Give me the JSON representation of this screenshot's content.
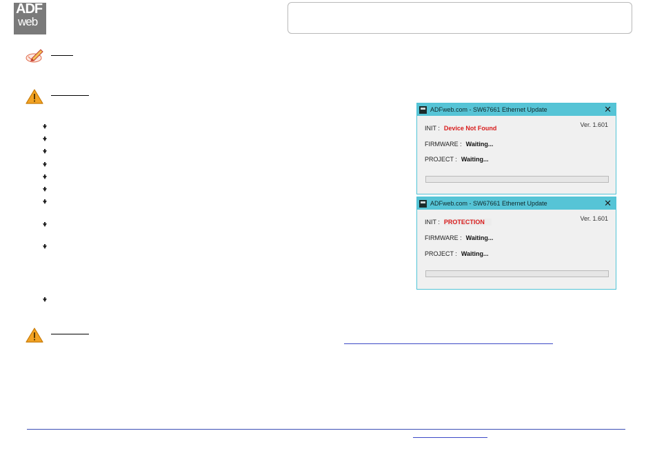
{
  "logo": {
    "line1": "ADF",
    "line2": "web"
  },
  "windows": [
    {
      "title": "ADFweb.com - SW67661 Ethernet Update",
      "close_glyph": "✕",
      "version": "Ver. 1.601",
      "init_label": "INIT :",
      "init_value": "Device Not Found",
      "firmware_label": "FIRMWARE :",
      "firmware_value": "Waiting...",
      "project_label": "PROJECT :",
      "project_value": "Waiting...",
      "progress": 0
    },
    {
      "title": "ADFweb.com - SW67661 Ethernet Update",
      "close_glyph": "✕",
      "version": "Ver. 1.601",
      "init_label": "INIT :",
      "init_value": "PROTECTION",
      "firmware_label": "FIRMWARE :",
      "firmware_value": "Waiting...",
      "project_label": "PROJECT :",
      "project_value": "Waiting...",
      "progress": 0
    }
  ],
  "icons": {
    "note": "note-pencil-icon",
    "warning": "warning-triangle-icon",
    "bullet": "arrow-bullet-icon",
    "warning_color": "#f2a223",
    "accent": "#56c4d6",
    "error_color": "#d81b1b"
  }
}
